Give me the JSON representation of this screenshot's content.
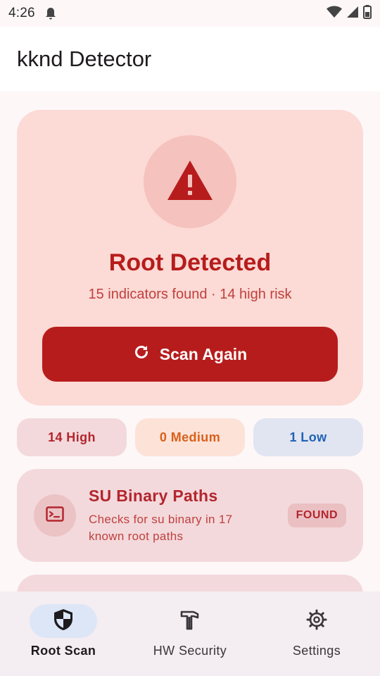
{
  "status_bar": {
    "time": "4:26",
    "icons": [
      "notification-bell-icon",
      "wifi-icon",
      "cell-signal-icon",
      "battery-icon"
    ]
  },
  "app_bar": {
    "title": "kknd Detector"
  },
  "hero": {
    "icon": "warning-triangle-icon",
    "title": "Root Detected",
    "subtitle": "15 indicators found · 14 high risk",
    "scan_button": {
      "icon": "refresh-icon",
      "label": "Scan Again"
    }
  },
  "counters": {
    "high": "14 High",
    "medium": "0 Medium",
    "low": "1 Low"
  },
  "checks": [
    {
      "icon": "terminal-icon",
      "title": "SU Binary Paths",
      "description": "Checks for su binary in 17 known root paths",
      "badge": "FOUND"
    }
  ],
  "bottom_nav": [
    {
      "icon": "shield-icon",
      "label": "Root Scan",
      "active": true
    },
    {
      "icon": "hammer-icon",
      "label": "HW Security",
      "active": false
    },
    {
      "icon": "gear-icon",
      "label": "Settings",
      "active": false
    }
  ],
  "colors": {
    "danger": "#b71c1c",
    "hero_background": "#fcdad5",
    "medium": "#d8601a",
    "low": "#1e63b5",
    "nav_active": "#dde6f6"
  }
}
